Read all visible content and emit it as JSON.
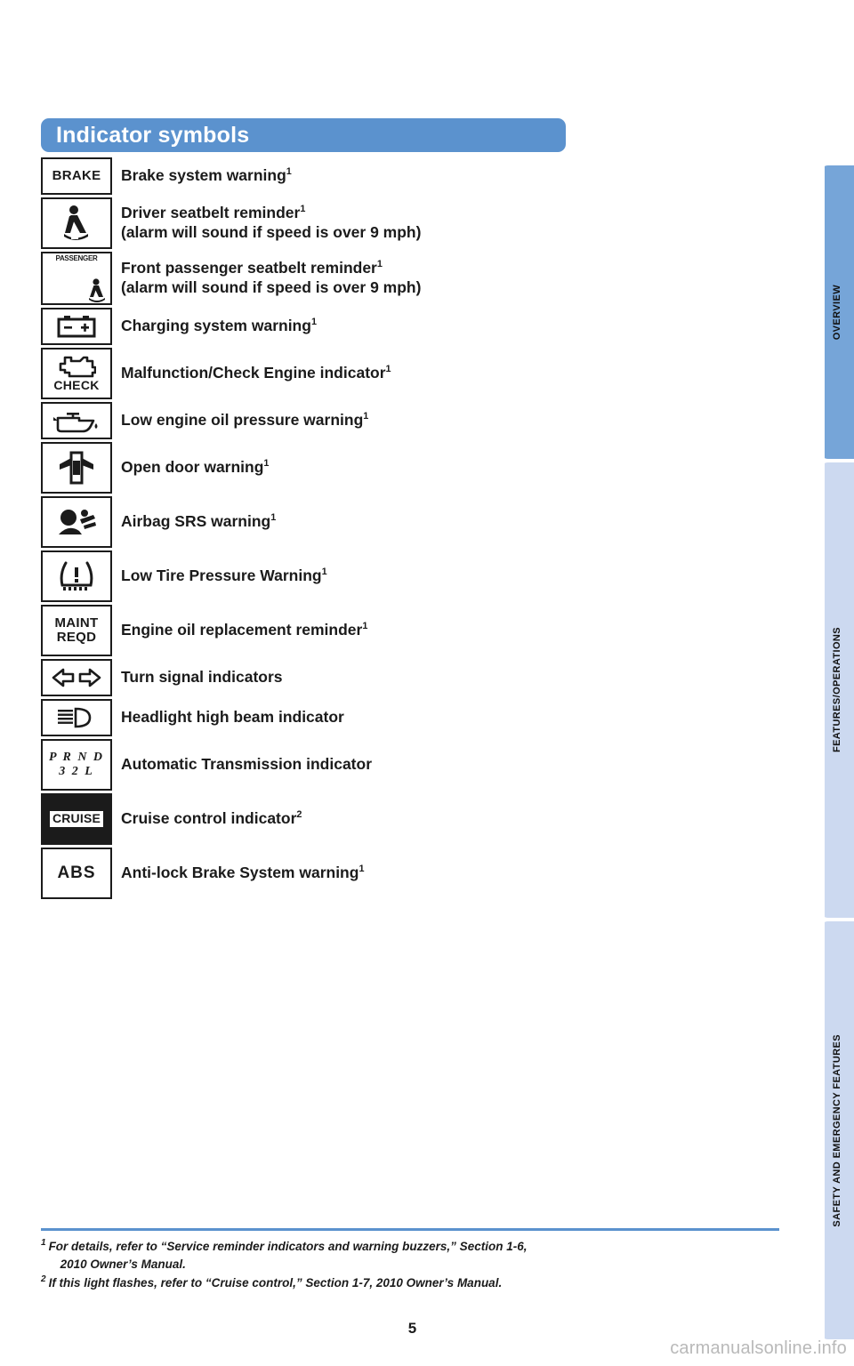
{
  "section": {
    "title": "Indicator symbols",
    "header_color": "#5b92ce"
  },
  "indicators": [
    {
      "symbol_kind": "text",
      "symbol_text": "BRAKE",
      "icon_name": "brake-text-icon",
      "label": "Brake system warning",
      "footnote": "1",
      "sub": ""
    },
    {
      "symbol_kind": "svg",
      "icon_name": "driver-seatbelt-icon",
      "label": "Driver seatbelt reminder",
      "footnote": "1",
      "sub": "(alarm will sound if speed is over 9 mph)"
    },
    {
      "symbol_kind": "passenger",
      "icon_name": "front-passenger-seatbelt-icon",
      "symbol_text": "PASSENGER",
      "label": "Front passenger seatbelt reminder",
      "footnote": "1",
      "sub": "(alarm will sound if speed is over 9 mph)"
    },
    {
      "symbol_kind": "svg",
      "icon_name": "battery-icon",
      "label": "Charging system warning",
      "footnote": "1",
      "sub": ""
    },
    {
      "symbol_kind": "svg",
      "icon_name": "check-engine-icon",
      "symbol_text": "CHECK",
      "label": "Malfunction/Check Engine indicator",
      "footnote": "1",
      "sub": ""
    },
    {
      "symbol_kind": "svg",
      "icon_name": "oil-can-icon",
      "label": "Low engine oil pressure warning",
      "footnote": "1",
      "sub": ""
    },
    {
      "symbol_kind": "svg",
      "icon_name": "open-door-icon",
      "label": "Open door warning",
      "footnote": "1",
      "sub": ""
    },
    {
      "symbol_kind": "svg",
      "icon_name": "airbag-srs-icon",
      "label": "Airbag SRS warning",
      "footnote": "1",
      "sub": ""
    },
    {
      "symbol_kind": "svg",
      "icon_name": "low-tire-pressure-icon",
      "label": "Low Tire Pressure Warning",
      "footnote": "1",
      "sub": ""
    },
    {
      "symbol_kind": "text",
      "icon_name": "maint-reqd-text-icon",
      "symbol_text": "MAINT\nREQD",
      "label": "Engine oil replacement reminder",
      "footnote": "1",
      "sub": ""
    },
    {
      "symbol_kind": "svg",
      "icon_name": "turn-signal-arrows-icon",
      "label": "Turn signal indicators",
      "footnote": "",
      "sub": ""
    },
    {
      "symbol_kind": "svg",
      "icon_name": "high-beam-icon",
      "label": "Headlight high beam indicator",
      "footnote": "",
      "sub": ""
    },
    {
      "symbol_kind": "prnd",
      "icon_name": "automatic-transmission-icon",
      "symbol_line1": "P R N D",
      "symbol_line2": "3 2 L",
      "label": "Automatic Transmission indicator",
      "footnote": "",
      "sub": ""
    },
    {
      "symbol_kind": "inverted-text",
      "icon_name": "cruise-text-icon",
      "symbol_text": "CRUISE",
      "label": "Cruise control indicator",
      "footnote": "2",
      "sub": ""
    },
    {
      "symbol_kind": "text",
      "icon_name": "abs-text-icon",
      "symbol_text": "ABS",
      "label": "Anti-lock Brake System warning",
      "footnote": "1",
      "sub": ""
    }
  ],
  "footnotes": [
    {
      "mark": "1",
      "line1": "For details, refer to “Service reminder indicators and warning buzzers,” Section 1-6,",
      "line2": "2010 Owner’s Manual."
    },
    {
      "mark": "2",
      "line1": "If this light flashes, refer to “Cruise control,” Section 1-7, 2010 Owner’s Manual.",
      "line2": ""
    }
  ],
  "side_tabs": [
    {
      "label": "OVERVIEW",
      "color": "#76a5d8",
      "active": true
    },
    {
      "label": "FEATURES/OPERATIONS",
      "color": "#ccd9f0",
      "active": false
    },
    {
      "label": "SAFETY AND EMERGENCY FEATURES",
      "color": "#ccd9f0",
      "active": false
    }
  ],
  "page_number": "5",
  "watermark": "carmanualsonline.info"
}
